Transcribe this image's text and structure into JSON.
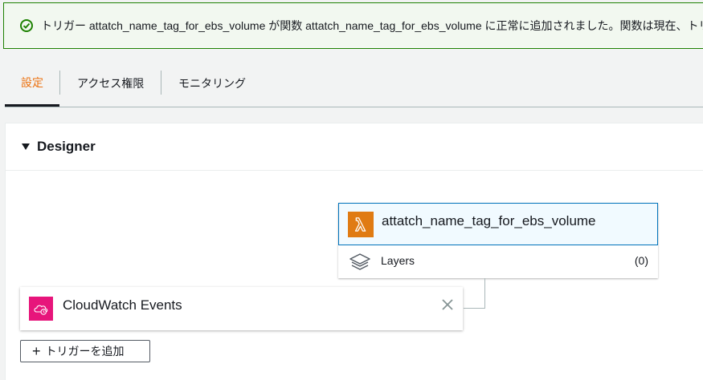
{
  "flash": {
    "message": "トリガー attatch_name_tag_for_ebs_volume が関数 attatch_name_tag_for_ebs_volume に正常に追加されました。関数は現在、トリガーからのイベントを受信しています。"
  },
  "tabs": [
    {
      "label": "設定"
    },
    {
      "label": "アクセス権限"
    },
    {
      "label": "モニタリング"
    }
  ],
  "designer": {
    "title": "Designer",
    "function_name": "attatch_name_tag_for_ebs_volume",
    "layers_label": "Layers",
    "layers_count": "(0)",
    "trigger_name": "CloudWatch Events",
    "add_trigger_label": "トリガーを追加"
  },
  "colors": {
    "success": "#1d8102",
    "active_tab": "#ec7211",
    "lambda": "#e07b13",
    "cloudwatch": "#e7157b",
    "selected_border": "#0073bb"
  },
  "icons": [
    "success-check-icon",
    "lambda-icon",
    "layers-icon",
    "cloudwatch-events-icon",
    "close-icon",
    "plus-icon",
    "caret-down-icon"
  ]
}
